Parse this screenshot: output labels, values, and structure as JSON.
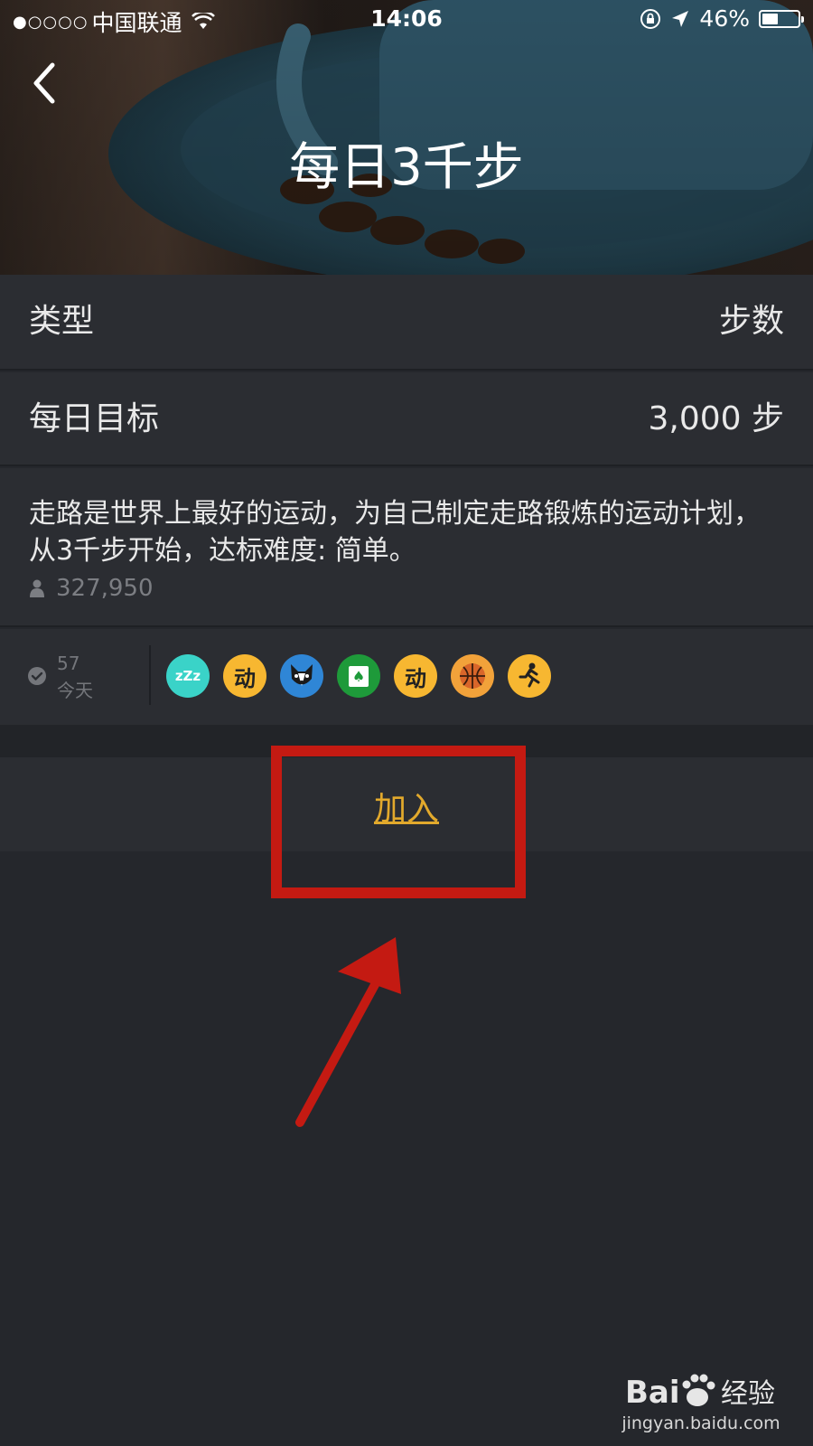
{
  "status_bar": {
    "signal_dots": "●○○○○",
    "carrier": "中国联通",
    "time": "14:06",
    "battery_percent": "46%",
    "battery_level": 0.46
  },
  "header": {
    "title": "每日3千步"
  },
  "rows": {
    "type_label": "类型",
    "type_value": "步数",
    "goal_label": "每日目标",
    "goal_value": "3,000 步"
  },
  "description": {
    "text": "走路是世界上最好的运动，为自己制定走路锻炼的运动计划，从3千步开始，达标难度: 简单。",
    "participants": "327,950"
  },
  "today": {
    "count": "57",
    "label": "今天",
    "badges": [
      {
        "icon": "sleep-icon",
        "glyph": "zZz",
        "bg": "#3ad3c8",
        "fg": "#ffffff"
      },
      {
        "icon": "move-icon",
        "glyph": "动",
        "bg": "#f7b731",
        "fg": "#222222"
      },
      {
        "icon": "dog-avatar-icon",
        "glyph": "",
        "bg": "#2f86d6",
        "fg": "#ffffff"
      },
      {
        "icon": "spade-card-icon",
        "glyph": "♠",
        "bg": "#1e9a3a",
        "fg": "#ffffff"
      },
      {
        "icon": "move-icon",
        "glyph": "动",
        "bg": "#f7b731",
        "fg": "#222222"
      },
      {
        "icon": "basketball-icon",
        "glyph": "",
        "bg": "#f2a23a",
        "fg": "#222222"
      },
      {
        "icon": "runner-icon",
        "glyph": "",
        "bg": "#f7b731",
        "fg": "#222222"
      }
    ]
  },
  "join": {
    "label": "加入"
  },
  "watermark": {
    "brand": "Bai 经验",
    "domain": "jingyan.baidu.com"
  },
  "colors": {
    "accent": "#e2a92c",
    "annotation": "#c41a12",
    "background": "#25272c",
    "row": "#2b2d32"
  }
}
